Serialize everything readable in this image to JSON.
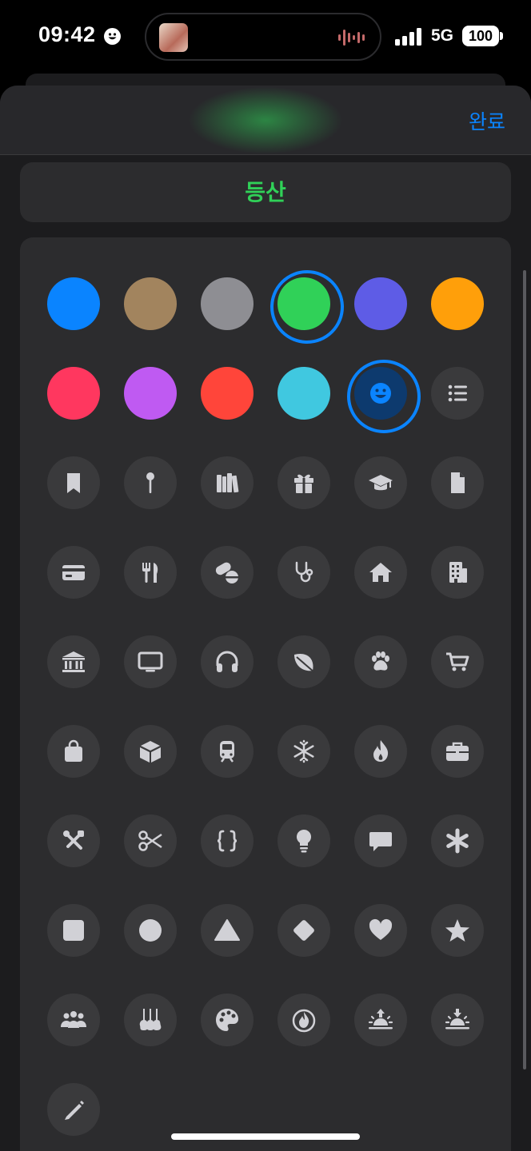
{
  "status": {
    "time": "09:42",
    "network": "5G",
    "battery": "100"
  },
  "header": {
    "done_label": "완료"
  },
  "list": {
    "name": "등산"
  },
  "colors": [
    {
      "name": "blue",
      "hex": "#0a84ff",
      "selected": false
    },
    {
      "name": "brown",
      "hex": "#a2845e",
      "selected": false
    },
    {
      "name": "gray",
      "hex": "#8e8e93",
      "selected": false
    },
    {
      "name": "green",
      "hex": "#30d158",
      "selected": true
    },
    {
      "name": "indigo",
      "hex": "#5e5ce6",
      "selected": false
    },
    {
      "name": "orange",
      "hex": "#ff9f0a",
      "selected": false
    },
    {
      "name": "pink",
      "hex": "#ff375f",
      "selected": false
    },
    {
      "name": "purple",
      "hex": "#bf5af2",
      "selected": false
    },
    {
      "name": "red",
      "hex": "#ff453a",
      "selected": false
    },
    {
      "name": "cyan",
      "hex": "#40c8e0",
      "selected": false
    }
  ],
  "icons": [
    "smiley-icon",
    "list-bullet-icon",
    "bookmark-icon",
    "pin-icon",
    "books-icon",
    "gift-icon",
    "graduation-cap-icon",
    "document-icon",
    "credit-card-icon",
    "fork-knife-icon",
    "pills-icon",
    "stethoscope-icon",
    "house-icon",
    "building-icon",
    "bank-icon",
    "tv-icon",
    "headphones-icon",
    "leaf-icon",
    "paw-icon",
    "cart-icon",
    "bag-icon",
    "box-icon",
    "train-icon",
    "snowflake-icon",
    "flame-icon",
    "briefcase-icon",
    "tools-icon",
    "scissors-icon",
    "curly-braces-icon",
    "lightbulb-icon",
    "speech-bubble-icon",
    "asterisk-icon",
    "square-icon",
    "circle-icon",
    "triangle-icon",
    "diamond-icon",
    "heart-icon",
    "star-icon",
    "people-icon",
    "guitars-icon",
    "palette-icon",
    "campfire-icon",
    "sunrise-icon",
    "sunset-icon",
    "pencil-icon"
  ],
  "selected_icon": "smiley-icon",
  "accent": "#0a84ff",
  "icon_color": "#d1d1d6"
}
